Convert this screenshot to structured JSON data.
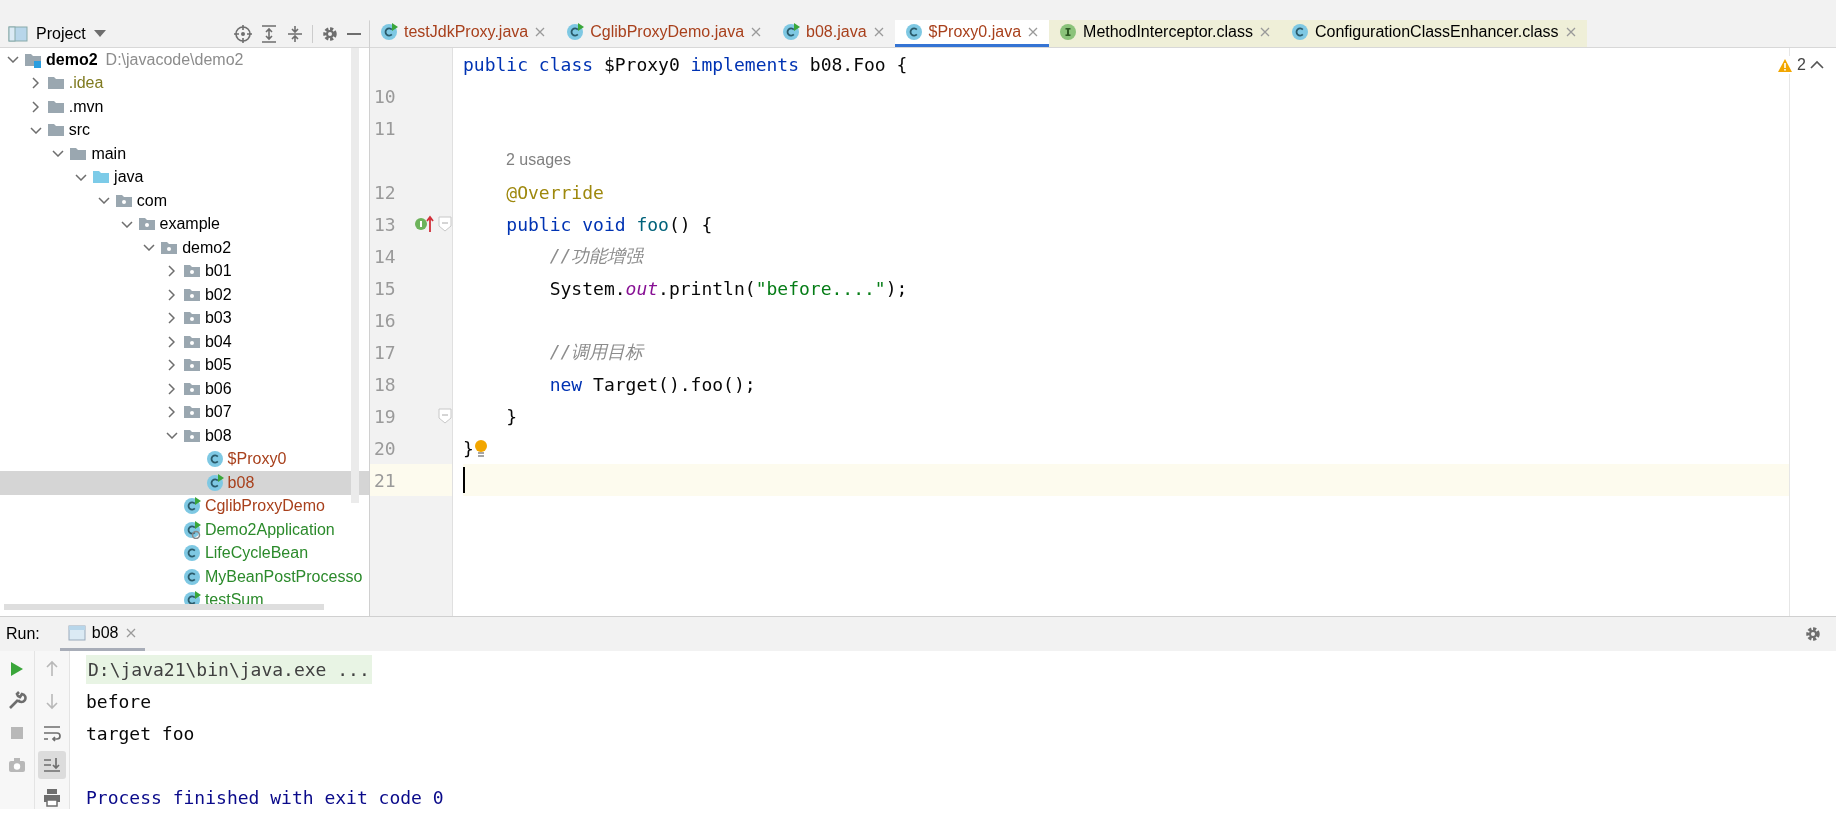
{
  "project_panel": {
    "title": "Project",
    "tree": [
      {
        "label": "demo2",
        "kind": "module",
        "location": "D:\\javacode\\demo2",
        "expanded": true,
        "selected": false,
        "color": "#000000",
        "children": [
          {
            "label": ".idea",
            "kind": "folder",
            "expanded": false,
            "selected": false,
            "color": "#7f7a1f"
          },
          {
            "label": ".mvn",
            "kind": "folder",
            "expanded": false,
            "selected": false,
            "color": "#000000"
          },
          {
            "label": "src",
            "kind": "folder",
            "expanded": true,
            "selected": false,
            "color": "#000000",
            "children": [
              {
                "label": "main",
                "kind": "folder",
                "expanded": true,
                "selected": false,
                "color": "#000000",
                "children": [
                  {
                    "label": "java",
                    "kind": "source-folder",
                    "expanded": true,
                    "selected": false,
                    "color": "#000000",
                    "children": [
                      {
                        "label": "com",
                        "kind": "package",
                        "expanded": true,
                        "selected": false,
                        "color": "#000000",
                        "children": [
                          {
                            "label": "example",
                            "kind": "package",
                            "expanded": true,
                            "selected": false,
                            "color": "#000000",
                            "children": [
                              {
                                "label": "demo2",
                                "kind": "package",
                                "expanded": true,
                                "selected": false,
                                "color": "#000000",
                                "children": [
                                  {
                                    "label": "b01",
                                    "kind": "package",
                                    "expanded": false,
                                    "selected": false,
                                    "color": "#000000"
                                  },
                                  {
                                    "label": "b02",
                                    "kind": "package",
                                    "expanded": false,
                                    "selected": false,
                                    "color": "#000000"
                                  },
                                  {
                                    "label": "b03",
                                    "kind": "package",
                                    "expanded": false,
                                    "selected": false,
                                    "color": "#000000"
                                  },
                                  {
                                    "label": "b04",
                                    "kind": "package",
                                    "expanded": false,
                                    "selected": false,
                                    "color": "#000000"
                                  },
                                  {
                                    "label": "b05",
                                    "kind": "package",
                                    "expanded": false,
                                    "selected": false,
                                    "color": "#000000"
                                  },
                                  {
                                    "label": "b06",
                                    "kind": "package",
                                    "expanded": false,
                                    "selected": false,
                                    "color": "#000000"
                                  },
                                  {
                                    "label": "b07",
                                    "kind": "package",
                                    "expanded": false,
                                    "selected": false,
                                    "color": "#000000"
                                  },
                                  {
                                    "label": "b08",
                                    "kind": "package",
                                    "expanded": true,
                                    "selected": false,
                                    "color": "#000000",
                                    "children": [
                                      {
                                        "label": "$Proxy0",
                                        "kind": "class",
                                        "selected": false,
                                        "color": "#a8401c"
                                      },
                                      {
                                        "label": "b08",
                                        "kind": "class-run",
                                        "selected": true,
                                        "color": "#a8401c"
                                      }
                                    ]
                                  },
                                  {
                                    "label": "CglibProxyDemo",
                                    "kind": "class-run",
                                    "selected": false,
                                    "color": "#a8401c"
                                  },
                                  {
                                    "label": "Demo2Application",
                                    "kind": "spring-app",
                                    "selected": false,
                                    "color": "#2b8a2b"
                                  },
                                  {
                                    "label": "LifeCycleBean",
                                    "kind": "class",
                                    "selected": false,
                                    "color": "#2b8a2b"
                                  },
                                  {
                                    "label": "MyBeanPostProcesso",
                                    "kind": "class",
                                    "selected": false,
                                    "color": "#2b8a2b"
                                  },
                                  {
                                    "label": "testSum",
                                    "kind": "class-run",
                                    "selected": false,
                                    "color": "#2b8a2b"
                                  }
                                ]
                              }
                            ]
                          }
                        ]
                      }
                    ]
                  }
                ]
              }
            ]
          }
        ]
      }
    ]
  },
  "editor": {
    "tabs": [
      {
        "label": "testJdkProxy.java",
        "kind": "class-run",
        "selected": false,
        "library": false,
        "color": "#a8401c"
      },
      {
        "label": "CglibProxyDemo.java",
        "kind": "class-run",
        "selected": false,
        "library": false,
        "color": "#a8401c"
      },
      {
        "label": "b08.java",
        "kind": "class-run",
        "selected": false,
        "library": false,
        "color": "#a8401c"
      },
      {
        "label": "$Proxy0.java",
        "kind": "class",
        "selected": true,
        "library": false,
        "color": "#a8401c"
      },
      {
        "label": "MethodInterceptor.class",
        "kind": "interface",
        "selected": false,
        "library": true,
        "color": "#000000"
      },
      {
        "label": "ConfigurationClassEnhancer.class",
        "kind": "class",
        "selected": false,
        "library": true,
        "color": "#000000"
      }
    ],
    "warnings": "2",
    "lines": [
      {
        "kind": "code",
        "tokens": [
          {
            "kind": "keyword",
            "text": "public"
          },
          {
            "kind": "keyword",
            "text": " class"
          },
          {
            "kind": "plain",
            "text": " $Proxy0 "
          },
          {
            "kind": "keyword",
            "text": "implements"
          },
          {
            "kind": "plain",
            "text": " b08.Foo {"
          }
        ]
      },
      {
        "kind": "code",
        "number": "10"
      },
      {
        "kind": "code",
        "number": "11"
      },
      {
        "kind": "hint",
        "text": "2 usages"
      },
      {
        "kind": "code",
        "number": "12",
        "tokens": [
          {
            "kind": "annotation",
            "text": "    @Override"
          }
        ]
      },
      {
        "kind": "code",
        "number": "13",
        "overrides": true,
        "fold": true,
        "tokens": [
          {
            "kind": "keyword",
            "text": "    public"
          },
          {
            "kind": "keyword",
            "text": " void"
          },
          {
            "kind": "method",
            "text": " foo"
          },
          {
            "kind": "plain",
            "text": "() {"
          }
        ]
      },
      {
        "kind": "code",
        "number": "14",
        "tokens": [
          {
            "kind": "comment",
            "text": "        //功能增强"
          }
        ]
      },
      {
        "kind": "code",
        "number": "15",
        "tokens": [
          {
            "kind": "plain",
            "text": "        System."
          },
          {
            "kind": "field",
            "text": "out"
          },
          {
            "kind": "plain",
            "text": ".println("
          },
          {
            "kind": "string",
            "text": "\"before....\""
          },
          {
            "kind": "plain",
            "text": ");"
          }
        ]
      },
      {
        "kind": "code",
        "number": "16"
      },
      {
        "kind": "code",
        "number": "17",
        "tokens": [
          {
            "kind": "comment",
            "text": "        //调用目标"
          }
        ]
      },
      {
        "kind": "code",
        "number": "18",
        "tokens": [
          {
            "kind": "keyword",
            "text": "        new"
          },
          {
            "kind": "plain",
            "text": " Target().foo();"
          }
        ]
      },
      {
        "kind": "code",
        "number": "19",
        "fold": true,
        "tokens": [
          {
            "kind": "plain",
            "text": "    }"
          }
        ]
      },
      {
        "kind": "code",
        "number": "20",
        "bulb": true,
        "tokens": [
          {
            "kind": "plain",
            "text": "}"
          }
        ]
      },
      {
        "kind": "code",
        "number": "21",
        "current": true
      }
    ]
  },
  "run_panel": {
    "label": "Run:",
    "tabs": [
      {
        "label": "b08",
        "selected": true
      }
    ],
    "toolbar": [
      {
        "kind": "run",
        "disabled": false
      },
      {
        "kind": "wrench",
        "disabled": false
      },
      {
        "kind": "stop",
        "disabled": true
      },
      {
        "kind": "camera",
        "disabled": true
      }
    ],
    "side_toolbar": [
      {
        "kind": "up",
        "disabled": true,
        "selected": false
      },
      {
        "kind": "down",
        "disabled": true,
        "selected": false
      },
      {
        "kind": "wrap",
        "disabled": false,
        "selected": false
      },
      {
        "kind": "scroll-end",
        "disabled": false,
        "selected": true
      },
      {
        "kind": "print",
        "disabled": false,
        "selected": false
      }
    ],
    "console": [
      {
        "kind": "command",
        "text": "D:\\java21\\bin\\java.exe ..."
      },
      {
        "kind": "stdout",
        "text": "before"
      },
      {
        "kind": "stdout",
        "text": "target foo"
      },
      {
        "kind": "system",
        "text": "Process finished with exit code 0"
      }
    ]
  }
}
